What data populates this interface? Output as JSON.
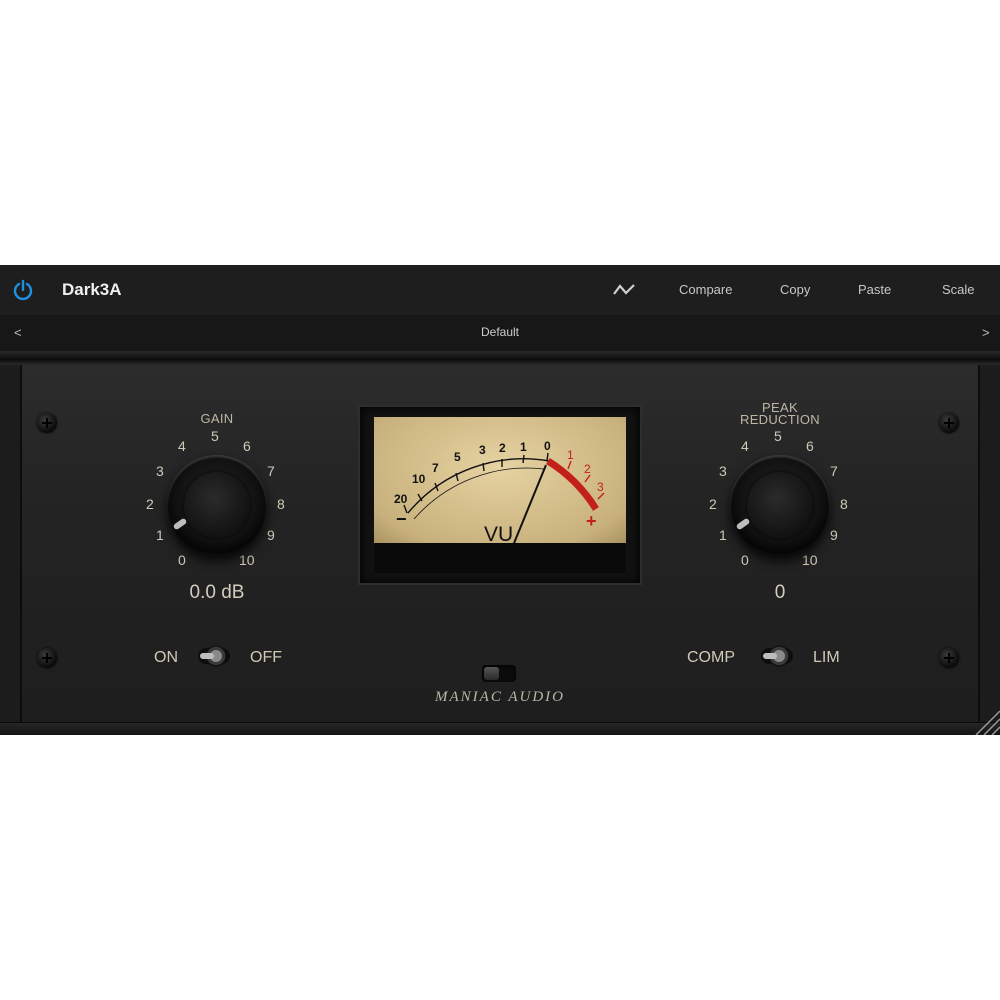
{
  "host": {
    "plugin_name": "Dark3A",
    "buttons": {
      "compare": "Compare",
      "copy": "Copy",
      "paste": "Paste",
      "scale": "Scale"
    },
    "preset": {
      "prev": "<",
      "name": "Default",
      "next": ">"
    },
    "power_color": "#1e90e0"
  },
  "gain": {
    "label": "GAIN",
    "scale": [
      "0",
      "1",
      "2",
      "3",
      "4",
      "5",
      "6",
      "7",
      "8",
      "9",
      "10"
    ],
    "readout": "0.0 dB",
    "switch_on": "ON",
    "switch_off": "OFF"
  },
  "peak_reduction": {
    "label_line1": "PEAK",
    "label_line2": "REDUCTION",
    "scale": [
      "0",
      "1",
      "2",
      "3",
      "4",
      "5",
      "6",
      "7",
      "8",
      "9",
      "10"
    ],
    "readout": "0",
    "switch_comp": "COMP",
    "switch_lim": "LIM"
  },
  "vu_meter": {
    "title": "VU",
    "black_scale": [
      "20",
      "10",
      "7",
      "5",
      "3",
      "2",
      "1",
      "0"
    ],
    "red_scale": [
      "1",
      "2",
      "3"
    ],
    "minus": "−",
    "plus": "+",
    "red_color": "#c4201a"
  },
  "brand": "MANIAC AUDIO"
}
